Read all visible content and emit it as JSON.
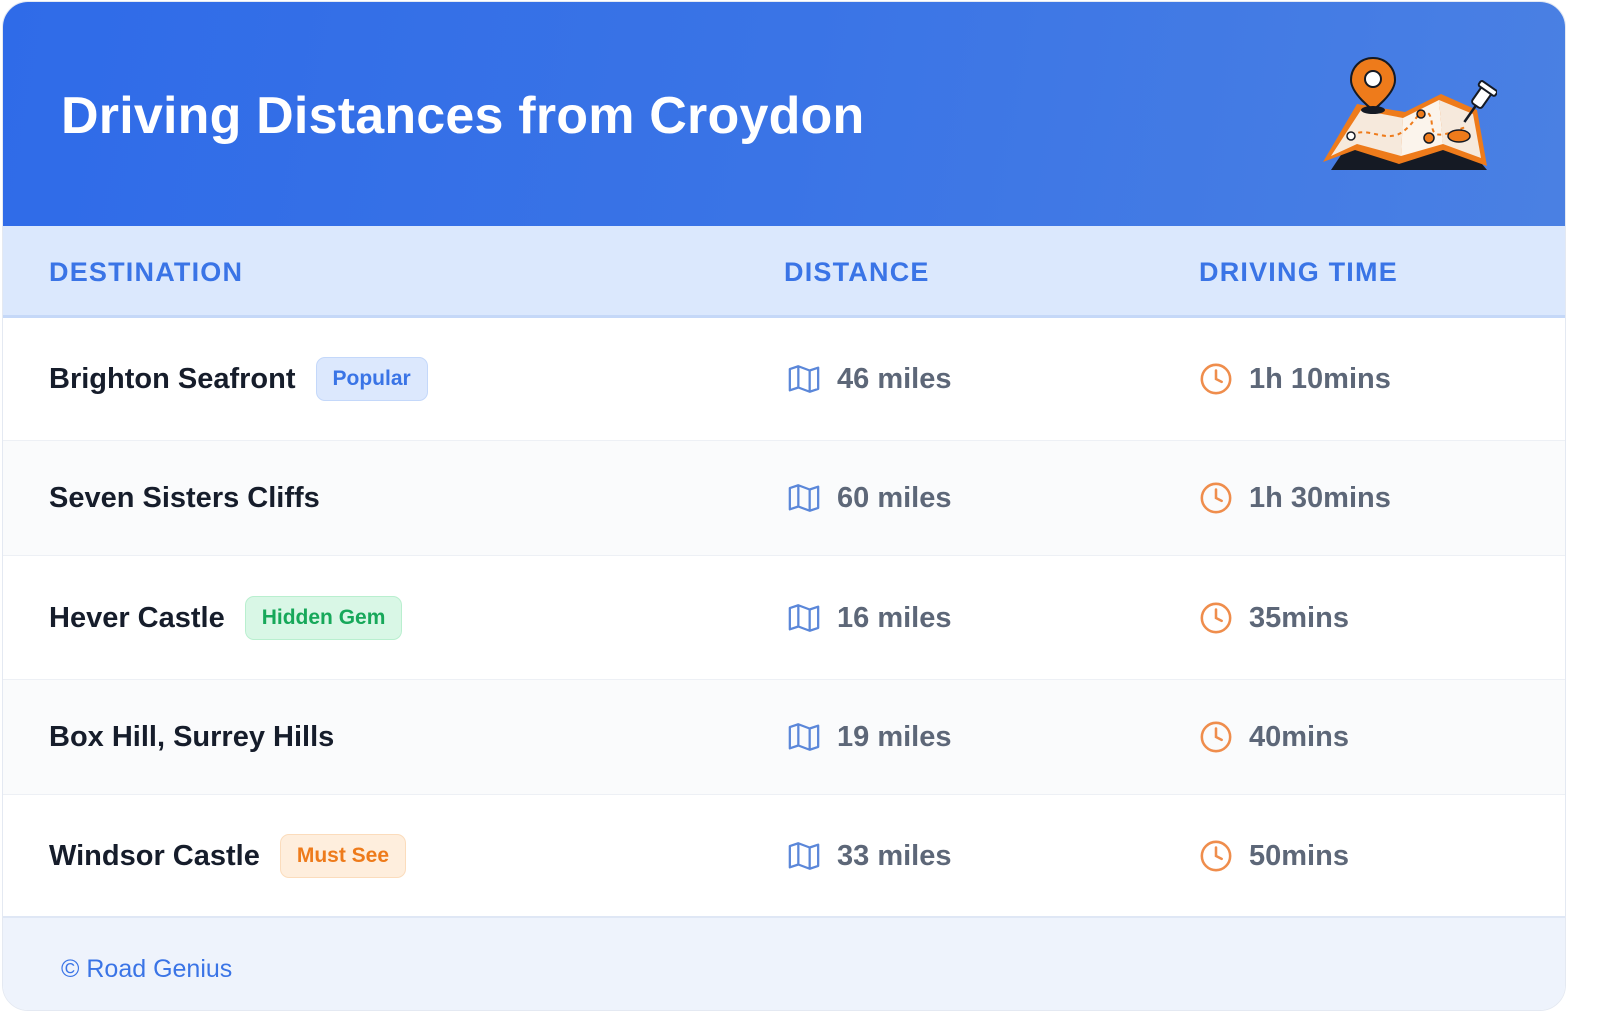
{
  "header": {
    "title": "Driving Distances from Croydon",
    "illustration": "map-with-pin-icon"
  },
  "table": {
    "columns": [
      "DESTINATION",
      "DISTANCE",
      "DRIVING TIME"
    ],
    "distance_icon": "map-icon",
    "time_icon": "clock-icon",
    "rows": [
      {
        "destination": "Brighton Seafront",
        "badge": "Popular",
        "distance": "46 miles",
        "time": "1h 10mins"
      },
      {
        "destination": "Seven Sisters Cliffs",
        "badge": "",
        "distance": "60 miles",
        "time": "1h 30mins"
      },
      {
        "destination": "Hever Castle",
        "badge": "Hidden Gem",
        "distance": "16 miles",
        "time": "35mins"
      },
      {
        "destination": "Box Hill, Surrey Hills",
        "badge": "",
        "distance": "19 miles",
        "time": "40mins"
      },
      {
        "destination": "Windsor Castle",
        "badge": "Must See",
        "distance": "33 miles",
        "time": "50mins"
      }
    ]
  },
  "badge_styles": {
    "Popular": {
      "bg": "#dce8fd",
      "border": "#c4d8fa",
      "color": "#3a74e6"
    },
    "Hidden Gem": {
      "bg": "#d9f7e6",
      "border": "#b9efcf",
      "color": "#17a85a"
    },
    "Must See": {
      "bg": "#feeedd",
      "border": "#fbdcbc",
      "color": "#ee7b1b"
    }
  },
  "colors": {
    "header_start": "#2f6be8",
    "header_end": "#4a80e3",
    "accent": "#3a74e6",
    "map_icon": "#5b87d9",
    "clock_icon": "#ef8d4c"
  },
  "footer": {
    "text": "© Road Genius"
  }
}
